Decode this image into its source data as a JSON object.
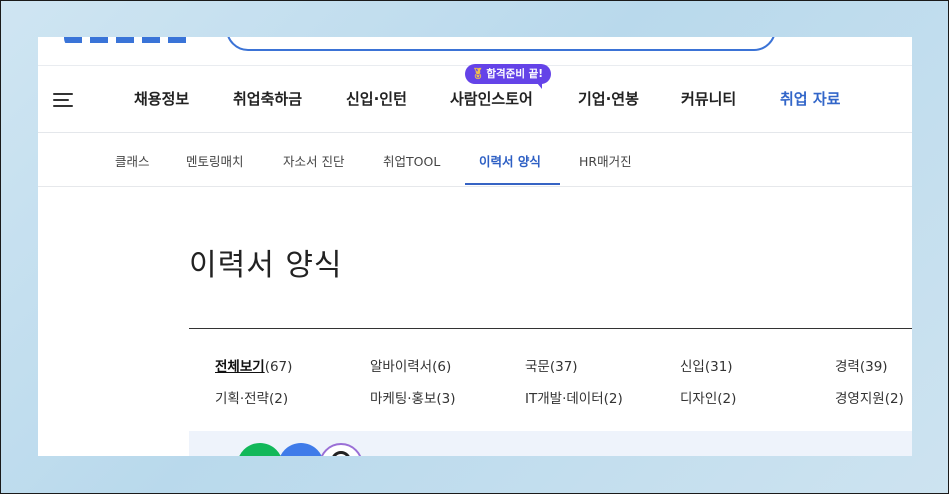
{
  "gnb": {
    "items": [
      {
        "label": "채용정보"
      },
      {
        "label": "취업축하금"
      },
      {
        "label": "신입·인턴"
      },
      {
        "label": "사람인스토어"
      },
      {
        "label": "기업·연봉"
      },
      {
        "label": "커뮤니티"
      },
      {
        "label": "취업 자료",
        "active": true
      }
    ],
    "promo_badge": "합격준비 끝!"
  },
  "subnav": {
    "items": [
      {
        "label": "클래스"
      },
      {
        "label": "멘토링매치"
      },
      {
        "label": "자소서 진단"
      },
      {
        "label": "취업TOOL"
      },
      {
        "label": "이력서 양식",
        "active": true
      },
      {
        "label": "HR매거진"
      }
    ]
  },
  "page": {
    "title": "이력서 양식"
  },
  "filters": [
    {
      "label": "전체보기",
      "count": "(67)",
      "active": true
    },
    {
      "label": "알바이력서",
      "count": "(6)"
    },
    {
      "label": "국문",
      "count": "(37)"
    },
    {
      "label": "신입",
      "count": "(31)"
    },
    {
      "label": "경력",
      "count": "(39)"
    },
    {
      "label": "기획·전략",
      "count": "(2)"
    },
    {
      "label": "마케팅·홍보",
      "count": "(3)"
    },
    {
      "label": "IT개발·데이터",
      "count": "(2)"
    },
    {
      "label": "디자인",
      "count": "(2)"
    },
    {
      "label": "경영지원",
      "count": "(2)"
    }
  ],
  "colors": {
    "accent": "#3266c9",
    "badge": "#6443e8",
    "list_background": "#eef3fb"
  },
  "icons": [
    "menu-icon",
    "medal-icon"
  ]
}
